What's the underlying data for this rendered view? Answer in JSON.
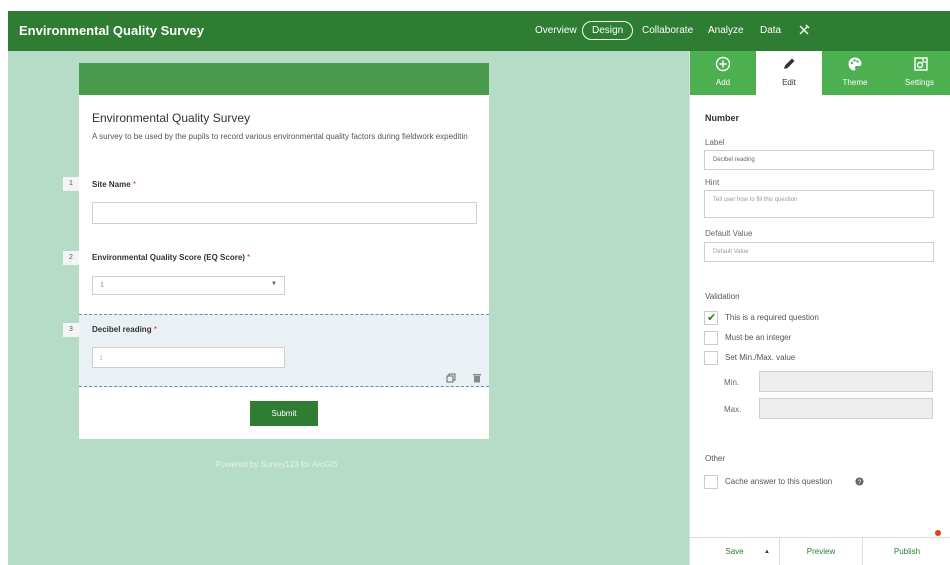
{
  "header": {
    "title": "Environmental Quality Survey",
    "nav": [
      {
        "label": "Overview"
      },
      {
        "label": "Design"
      },
      {
        "label": "Collaborate"
      },
      {
        "label": "Analyze"
      },
      {
        "label": "Data"
      }
    ],
    "tools_icon": "tools-icon",
    "active_nav": "Design"
  },
  "form": {
    "title": "Environmental Quality Survey",
    "description": "A survey to be used by the pupils to record various environmental quality factors during fieldwork expeditin",
    "required_marker": "*",
    "questions": [
      {
        "number": "1",
        "label": "Site Name",
        "type": "text",
        "value": ""
      },
      {
        "number": "2",
        "label": "Environmental Quality Score (EQ Score)",
        "type": "select",
        "value": "1"
      },
      {
        "number": "3",
        "label": "Decibel reading",
        "type": "number",
        "value": ""
      }
    ],
    "submit_label": "Submit",
    "powered_by": "Powered by Survey123 for ArcGIS"
  },
  "panel": {
    "tabs": [
      {
        "label": "Add",
        "icon": "add-circle-icon"
      },
      {
        "label": "Edit",
        "icon": "pencil-icon"
      },
      {
        "label": "Theme",
        "icon": "palette-icon"
      },
      {
        "label": "Settings",
        "icon": "settings-gear-icon"
      }
    ],
    "active_tab": "Edit",
    "heading": "Number",
    "label_caption": "Label",
    "label_value": "Decibel reading",
    "hint_caption": "Hint",
    "hint_placeholder": "Tell user how to fill this question",
    "default_caption": "Default Value",
    "default_placeholder": "Default Value",
    "validation_title": "Validation",
    "validation": [
      {
        "label": "This is a required question",
        "checked": true
      },
      {
        "label": "Must be an integer",
        "checked": false
      },
      {
        "label": "Set Min./Max. value",
        "checked": false
      }
    ],
    "min_label": "Min.",
    "max_label": "Max.",
    "other_title": "Other",
    "cache_label": "Cache answer to this question",
    "footer": {
      "save": "Save",
      "preview": "Preview",
      "publish": "Publish"
    }
  },
  "colors": {
    "header_bg": "#2e7d32",
    "canvas_bg": "#b6dbc6",
    "tab_bg": "#4caf50",
    "required": "#d32f2f",
    "publish_dot": "#d84315"
  }
}
